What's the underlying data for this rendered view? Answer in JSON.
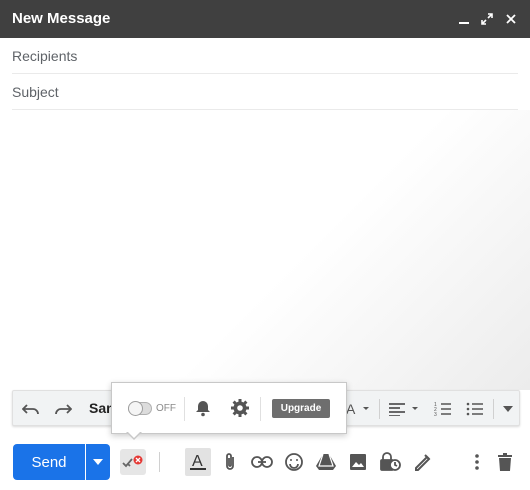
{
  "window": {
    "title": "New Message"
  },
  "fields": {
    "recipients_placeholder": "Recipients",
    "subject_placeholder": "Subject"
  },
  "format_bar": {
    "font_name": "San"
  },
  "popup": {
    "toggle_label": "OFF",
    "upgrade_label": "Upgrade"
  },
  "bottom_bar": {
    "send_label": "Send"
  },
  "colors": {
    "titlebar": "#404040",
    "send": "#1a73e8",
    "upgrade": "#6e6e6e"
  }
}
